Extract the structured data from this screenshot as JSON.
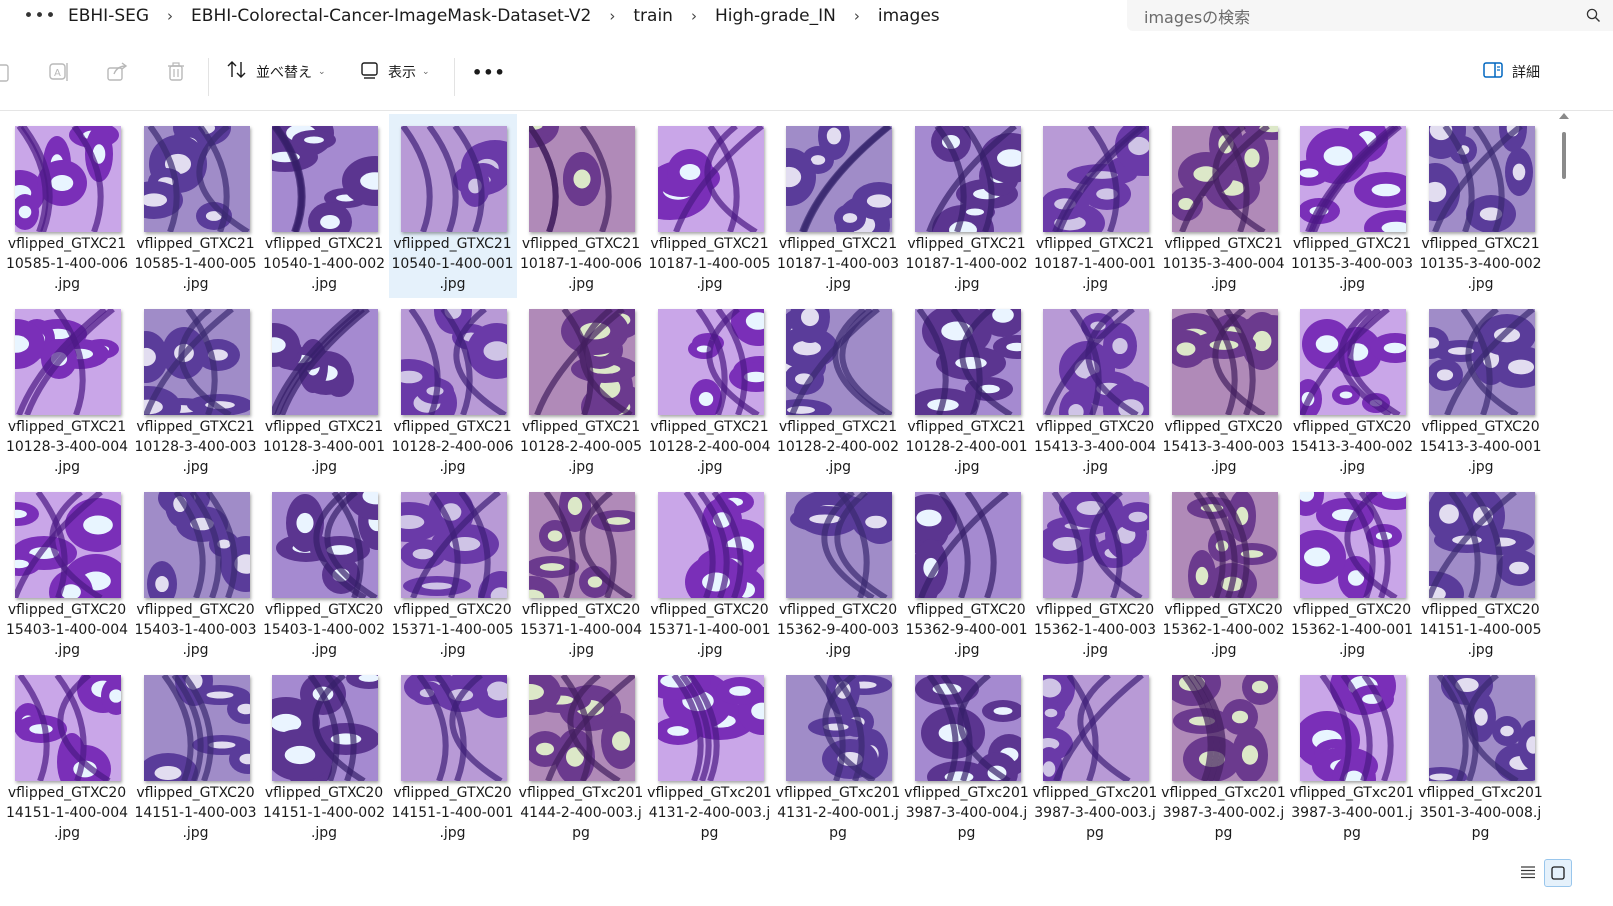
{
  "address": {
    "more": "•••",
    "crumbs": [
      "EBHI-SEG",
      "EBHI-Colorectal-Cancer-ImageMask-Dataset-V2",
      "train",
      "High-grade_IN",
      "images"
    ],
    "separator": "›"
  },
  "search": {
    "placeholder": "imagesの検索",
    "icon": "search-icon"
  },
  "toolbar": {
    "sort_label": "並べ替え",
    "view_label": "表示",
    "more_label": "•••",
    "details_label": "詳細"
  },
  "colors": {
    "selected": "#e5f1fb",
    "accent": "#0067c0"
  },
  "files": [
    {
      "line1": "vflipped_GTXC21",
      "line2": "10585-1-400-006",
      "line3": ".jpg"
    },
    {
      "line1": "vflipped_GTXC21",
      "line2": "10585-1-400-005",
      "line3": ".jpg"
    },
    {
      "line1": "vflipped_GTXC21",
      "line2": "10540-1-400-002",
      "line3": ".jpg"
    },
    {
      "line1": "vflipped_GTXC21",
      "line2": "10540-1-400-001",
      "line3": ".jpg",
      "selected": true
    },
    {
      "line1": "vflipped_GTXC21",
      "line2": "10187-1-400-006",
      "line3": ".jpg"
    },
    {
      "line1": "vflipped_GTXC21",
      "line2": "10187-1-400-005",
      "line3": ".jpg"
    },
    {
      "line1": "vflipped_GTXC21",
      "line2": "10187-1-400-003",
      "line3": ".jpg"
    },
    {
      "line1": "vflipped_GTXC21",
      "line2": "10187-1-400-002",
      "line3": ".jpg"
    },
    {
      "line1": "vflipped_GTXC21",
      "line2": "10187-1-400-001",
      "line3": ".jpg"
    },
    {
      "line1": "vflipped_GTXC21",
      "line2": "10135-3-400-004",
      "line3": ".jpg"
    },
    {
      "line1": "vflipped_GTXC21",
      "line2": "10135-3-400-003",
      "line3": ".jpg"
    },
    {
      "line1": "vflipped_GTXC21",
      "line2": "10135-3-400-002",
      "line3": ".jpg"
    },
    {
      "line1": "vflipped_GTXC21",
      "line2": "10128-3-400-004",
      "line3": ".jpg"
    },
    {
      "line1": "vflipped_GTXC21",
      "line2": "10128-3-400-003",
      "line3": ".jpg"
    },
    {
      "line1": "vflipped_GTXC21",
      "line2": "10128-3-400-001",
      "line3": ".jpg"
    },
    {
      "line1": "vflipped_GTXC21",
      "line2": "10128-2-400-006",
      "line3": ".jpg"
    },
    {
      "line1": "vflipped_GTXC21",
      "line2": "10128-2-400-005",
      "line3": ".jpg"
    },
    {
      "line1": "vflipped_GTXC21",
      "line2": "10128-2-400-004",
      "line3": ".jpg"
    },
    {
      "line1": "vflipped_GTXC21",
      "line2": "10128-2-400-002",
      "line3": ".jpg"
    },
    {
      "line1": "vflipped_GTXC21",
      "line2": "10128-2-400-001",
      "line3": ".jpg"
    },
    {
      "line1": "vflipped_GTXC20",
      "line2": "15413-3-400-004",
      "line3": ".jpg"
    },
    {
      "line1": "vflipped_GTXC20",
      "line2": "15413-3-400-003",
      "line3": ".jpg"
    },
    {
      "line1": "vflipped_GTXC20",
      "line2": "15413-3-400-002",
      "line3": ".jpg"
    },
    {
      "line1": "vflipped_GTXC20",
      "line2": "15413-3-400-001",
      "line3": ".jpg"
    },
    {
      "line1": "vflipped_GTXC20",
      "line2": "15403-1-400-004",
      "line3": ".jpg"
    },
    {
      "line1": "vflipped_GTXC20",
      "line2": "15403-1-400-003",
      "line3": ".jpg"
    },
    {
      "line1": "vflipped_GTXC20",
      "line2": "15403-1-400-002",
      "line3": ".jpg"
    },
    {
      "line1": "vflipped_GTXC20",
      "line2": "15371-1-400-005",
      "line3": ".jpg"
    },
    {
      "line1": "vflipped_GTXC20",
      "line2": "15371-1-400-004",
      "line3": ".jpg"
    },
    {
      "line1": "vflipped_GTXC20",
      "line2": "15371-1-400-001",
      "line3": ".jpg"
    },
    {
      "line1": "vflipped_GTXC20",
      "line2": "15362-9-400-003",
      "line3": ".jpg"
    },
    {
      "line1": "vflipped_GTXC20",
      "line2": "15362-9-400-001",
      "line3": ".jpg"
    },
    {
      "line1": "vflipped_GTXC20",
      "line2": "15362-1-400-003",
      "line3": ".jpg"
    },
    {
      "line1": "vflipped_GTXC20",
      "line2": "15362-1-400-002",
      "line3": ".jpg"
    },
    {
      "line1": "vflipped_GTXC20",
      "line2": "15362-1-400-001",
      "line3": ".jpg"
    },
    {
      "line1": "vflipped_GTXC20",
      "line2": "14151-1-400-005",
      "line3": ".jpg"
    },
    {
      "line1": "vflipped_GTXC20",
      "line2": "14151-1-400-004",
      "line3": ".jpg"
    },
    {
      "line1": "vflipped_GTXC20",
      "line2": "14151-1-400-003",
      "line3": ".jpg"
    },
    {
      "line1": "vflipped_GTXC20",
      "line2": "14151-1-400-002",
      "line3": ".jpg"
    },
    {
      "line1": "vflipped_GTXC20",
      "line2": "14151-1-400-001",
      "line3": ".jpg"
    },
    {
      "line1": "vflipped_GTxc201",
      "line2": "4144-2-400-003.j",
      "line3": "pg"
    },
    {
      "line1": "vflipped_GTxc201",
      "line2": "4131-2-400-003.j",
      "line3": "pg"
    },
    {
      "line1": "vflipped_GTxc201",
      "line2": "4131-2-400-001.j",
      "line3": "pg"
    },
    {
      "line1": "vflipped_GTxc201",
      "line2": "3987-3-400-004.j",
      "line3": "pg"
    },
    {
      "line1": "vflipped_GTxc201",
      "line2": "3987-3-400-003.j",
      "line3": "pg"
    },
    {
      "line1": "vflipped_GTxc201",
      "line2": "3987-3-400-002.j",
      "line3": "pg"
    },
    {
      "line1": "vflipped_GTxc201",
      "line2": "3987-3-400-001.j",
      "line3": "pg"
    },
    {
      "line1": "vflipped_GTxc201",
      "line2": "3501-3-400-008.j",
      "line3": "pg"
    }
  ],
  "thumb_palettes": [
    [
      "#7a2fb8",
      "#c9a6e8",
      "#4b1a85",
      "#e8f5ff"
    ],
    [
      "#6a3aa8",
      "#b89ad6",
      "#3e1f78",
      "#cfc4e6"
    ],
    [
      "#5a3c9a",
      "#a08cc8",
      "#3a2a70",
      "#e2ddf0"
    ],
    [
      "#6b3a8e",
      "#b08ab8",
      "#432060",
      "#dce8c8"
    ],
    [
      "#5b3590",
      "#a58ad0",
      "#361f6a",
      "#eaf4ff"
    ]
  ],
  "view_switch": {
    "list_icon": "list-view-icon",
    "thumb_icon": "large-icons-view-icon"
  }
}
